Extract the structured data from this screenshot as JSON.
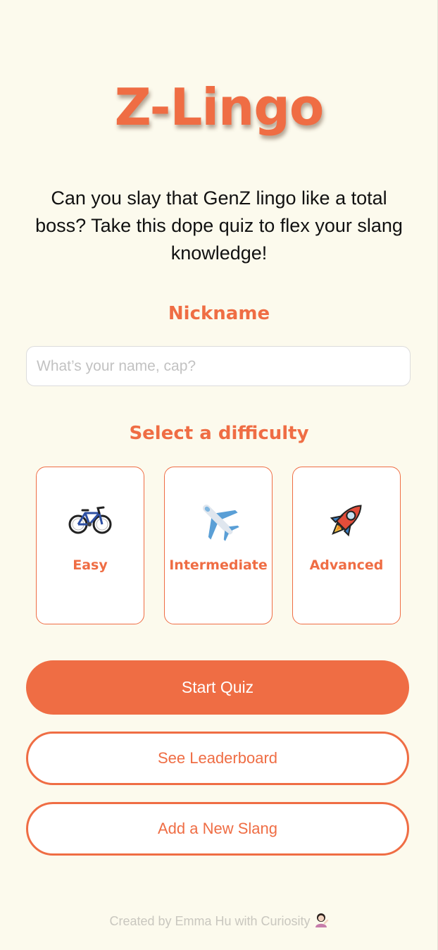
{
  "app": {
    "title": "Z-Lingo"
  },
  "intro": {
    "tagline": "Can you slay that GenZ lingo like a total boss? Take this dope quiz to flex your slang knowledge!"
  },
  "nickname": {
    "label": "Nickname",
    "placeholder": "What’s your name, cap?",
    "value": ""
  },
  "difficulty": {
    "label": "Select a difficulty",
    "options": [
      {
        "label": "Easy",
        "icon": "bicycle-icon"
      },
      {
        "label": "Intermediate",
        "icon": "airplane-icon"
      },
      {
        "label": "Advanced",
        "icon": "rocket-icon"
      }
    ]
  },
  "actions": {
    "start_label": "Start Quiz",
    "leaderboard_label": "See Leaderboard",
    "add_slang_label": "Add a New Slang"
  },
  "footer": {
    "credit": "Created by Emma Hu with Curiosity",
    "icon": "woman-tipping-hand-icon"
  },
  "colors": {
    "accent": "#ef6d44",
    "background": "#fcfaed",
    "card": "#ffffff"
  }
}
